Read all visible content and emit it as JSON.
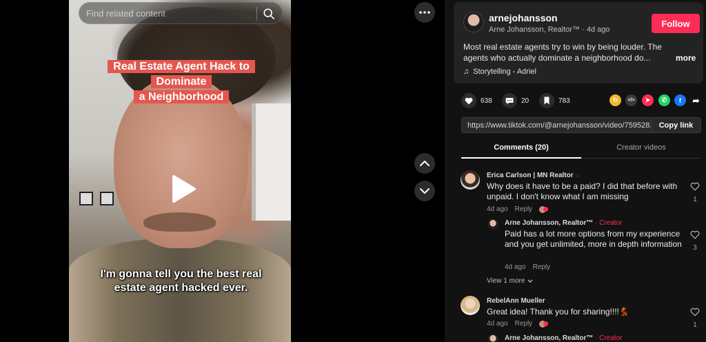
{
  "search": {
    "placeholder": "Find related content"
  },
  "video": {
    "overlay_title_line1": "Real Estate Agent Hack to Dominate",
    "overlay_title_line2": "a Neighborhood",
    "caption": "I'm gonna tell you the best real estate agent hacked ever."
  },
  "author": {
    "username": "arnejohansson",
    "subtitle": "Arne Johansson, Realtor™ · 4d ago",
    "follow_label": "Follow",
    "description": "Most real estate agents try to win by being louder. The agents who actually dominate a neighborhood do...",
    "more_label": "more",
    "music": "Storytelling - Adriel"
  },
  "stats": {
    "likes": "638",
    "comments": "20",
    "saves": "783"
  },
  "share": {
    "url": "https://www.tiktok.com/@arnejohansson/video/759528...",
    "copy_label": "Copy link"
  },
  "tabs": {
    "comments": "Comments (20)",
    "creator": "Creator videos"
  },
  "comments": [
    {
      "name": "Erica Carlson | MN Realtor",
      "text": "Why does it have to be a paid? I did that before with unpaid. I don't know what I am missing",
      "time": "4d ago",
      "reply_label": "Reply",
      "likes": "1",
      "reply": {
        "name": "Arne Johansson, Realtor™",
        "creator_label": "· Creator",
        "text": "Paid has a lot more options from my experience and you get unlimited, more in depth information",
        "time": "4d ago",
        "reply_label": "Reply",
        "likes": "3"
      },
      "view_more": "View 1 more"
    },
    {
      "name": "RebelAnn Mueller",
      "text": "Great idea! Thank you for sharing!!!!💃",
      "time": "4d ago",
      "reply_label": "Reply",
      "likes": "1",
      "next_reply_name": "Arne Johansson, Realtor™",
      "next_reply_creator": "· Creator"
    }
  ],
  "colors": {
    "accent": "#fe2c55",
    "panel_bg": "#121212",
    "card_bg": "#232323"
  }
}
